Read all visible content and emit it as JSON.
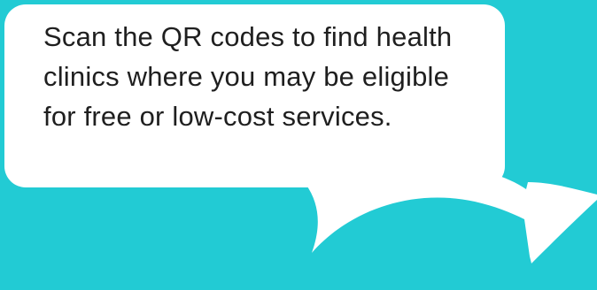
{
  "speech_bubble": {
    "text": "Scan the QR codes to find health clinics where you may be eligible for free or low-cost services."
  },
  "colors": {
    "background": "#22cbd4",
    "bubble": "#ffffff",
    "text": "#1f1f1f"
  },
  "icons": {
    "arrow": "curved-arrow-icon"
  }
}
